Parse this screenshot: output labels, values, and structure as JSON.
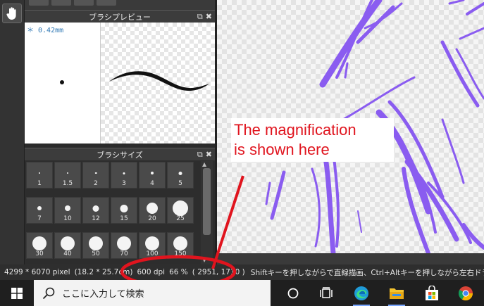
{
  "panels": {
    "brush_preview": {
      "title": "ブラシプレビュー",
      "size_label": "＊ 0.42mm"
    },
    "brush_size": {
      "title": "ブラシサイズ",
      "sizes": [
        "1",
        "1.5",
        "2",
        "3",
        "4",
        "5",
        "7",
        "10",
        "12",
        "15",
        "20",
        "25",
        "30",
        "40",
        "50",
        "70",
        "100",
        "150"
      ]
    }
  },
  "status_bar": {
    "pixels": "4299 * 6070 pixel",
    "dimensions": "(18.2 * 25.7cm)",
    "dpi": "600 dpi",
    "zoom": "66 %",
    "cursor": "( 2951, 1710 )",
    "hint": "Shiftキーを押しながらで直線描画、Ctrl+Altキーを押しながら左右ドラッグ"
  },
  "annotation": {
    "line1": "The magnification",
    "line2": "is shown here",
    "color": "#e0141e"
  },
  "taskbar": {
    "search_placeholder": "ここに入力して検索",
    "icons": [
      "windows-start-icon",
      "search-icon",
      "cortana-icon",
      "task-view-icon",
      "edge-icon",
      "file-explorer-icon",
      "store-icon",
      "chrome-icon"
    ]
  },
  "colors": {
    "stroke_purple": "#8a5cf0",
    "annotation_red": "#e0141e"
  }
}
